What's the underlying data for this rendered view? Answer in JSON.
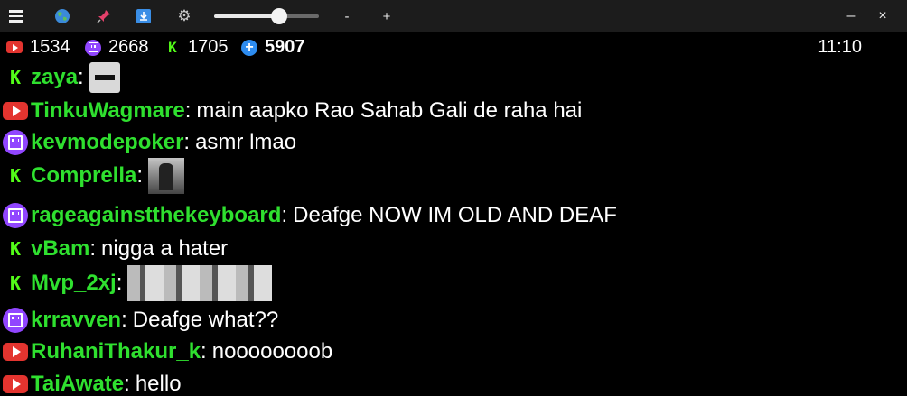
{
  "toolbar": {
    "menu_icon": "hamburger-icon",
    "globe_icon": "globe-icon",
    "pin_icon": "pin-icon",
    "download_icon": "download-icon",
    "settings_icon": "gear-icon",
    "volume_level": 0.62,
    "zoom_minus": "-",
    "zoom_plus": "+",
    "minimize": "–",
    "close": "×"
  },
  "stats": {
    "youtube": "1534",
    "twitch": "2668",
    "kick": "1705",
    "total": "5907",
    "time": "11:10"
  },
  "chat": {
    "messages": [
      {
        "platform": "kick",
        "name": "zaya",
        "text": "",
        "emote": "face"
      },
      {
        "platform": "youtube",
        "name": "TinkuWagmare",
        "text": "main aapko Rao Sahab Gali de raha hai"
      },
      {
        "platform": "twitch",
        "name": "kevmodepoker",
        "text": "asmr lmao"
      },
      {
        "platform": "kick",
        "name": "Comprella",
        "text": "",
        "emote": "photo"
      },
      {
        "platform": "twitch",
        "name": "rageagainstthekeyboard",
        "text": "Deafge NOW IM OLD AND DEAF",
        "emoji": "😳"
      },
      {
        "platform": "kick",
        "name": "vBam",
        "text": "nigga a hater"
      },
      {
        "platform": "kick",
        "name": "Mvp_2xj",
        "text": "",
        "emote": "strip"
      },
      {
        "platform": "twitch",
        "name": "krravven",
        "text": "Deafge what??"
      },
      {
        "platform": "youtube",
        "name": "RuhaniThakur_k",
        "text": "noooooooob"
      },
      {
        "platform": "youtube",
        "name": "TaiAwate",
        "text": "hello"
      }
    ]
  },
  "colors": {
    "background": "#000000",
    "toolbar": "#1c1c1c",
    "username": "#2fe02f",
    "youtube": "#e3342f",
    "twitch": "#9146ff",
    "kick": "#53fc18"
  }
}
